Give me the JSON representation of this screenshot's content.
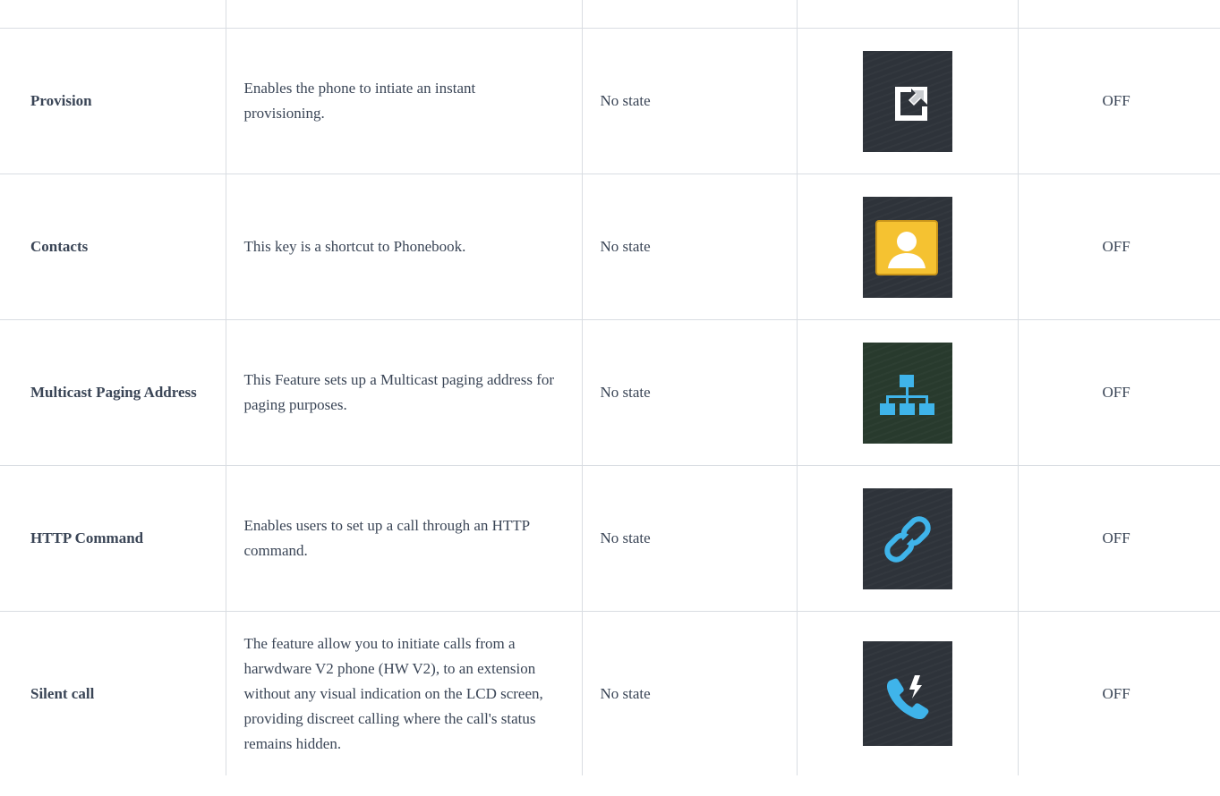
{
  "rows": [
    {
      "name": "Provision",
      "description": "Enables the phone to intiate an instant provisioning.",
      "state": "No state",
      "icon": "external-link-icon",
      "value": "OFF"
    },
    {
      "name": "Contacts",
      "description": "This key is a shortcut to Phonebook.",
      "state": "No state",
      "icon": "contact-person-icon",
      "value": "OFF"
    },
    {
      "name": "Multicast Paging Address",
      "description": "This Feature sets up a Multicast paging address for paging purposes.",
      "state": "No state",
      "icon": "network-tree-icon",
      "value": "OFF"
    },
    {
      "name": "HTTP Command",
      "description": "Enables users to set up a call through an HTTP command.",
      "state": "No state",
      "icon": "link-icon",
      "value": "OFF"
    },
    {
      "name": "Silent call",
      "description": "The feature allow you to initiate calls from a harwdware V2 phone (HW V2), to an extension without any visual indication on the LCD screen, providing discreet calling where the call's status remains hidden.",
      "state": "No state",
      "icon": "phone-flash-icon",
      "value": "OFF"
    }
  ],
  "colors": {
    "text": "#3a4556",
    "border": "#d9dde2",
    "icon_bg": "#2e333a",
    "contact_yellow": "#f5c231",
    "icon_blue": "#3fb4ea"
  }
}
